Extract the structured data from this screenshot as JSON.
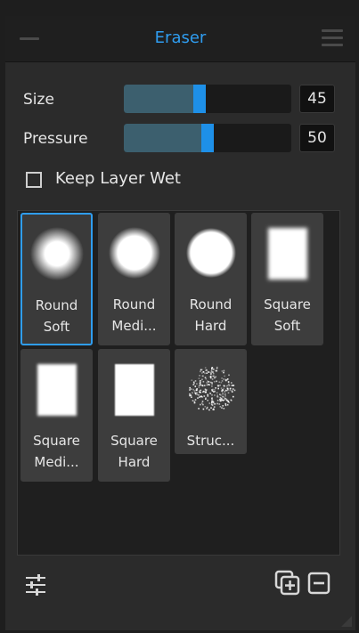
{
  "panel": {
    "title": "Eraser"
  },
  "controls": {
    "size": {
      "label": "Size",
      "value": "45",
      "fill_fraction": 0.45
    },
    "pressure": {
      "label": "Pressure",
      "value": "50",
      "fill_fraction": 0.5
    },
    "keep_layer_wet": {
      "label": "Keep Layer Wet",
      "checked": false
    }
  },
  "brushes": [
    {
      "line1": "Round",
      "line2": "Soft",
      "preview": "round-soft",
      "selected": true
    },
    {
      "line1": "Round",
      "line2": "Medi...",
      "preview": "round-medium",
      "selected": false
    },
    {
      "line1": "Round",
      "line2": "Hard",
      "preview": "round-hard",
      "selected": false
    },
    {
      "line1": "Square",
      "line2": "Soft",
      "preview": "square-soft",
      "selected": false
    },
    {
      "line1": "Square",
      "line2": "Medi...",
      "preview": "square-medium",
      "selected": false
    },
    {
      "line1": "Square",
      "line2": "Hard",
      "preview": "square-hard",
      "selected": false
    },
    {
      "line1": "Struc...",
      "line2": "",
      "preview": "structure",
      "selected": false
    }
  ],
  "colors": {
    "accent": "#2f9df0",
    "slider_thumb": "#1e90e8",
    "slider_fill": "#3c5f6e"
  },
  "icons": {
    "menu": "hamburger-menu-icon",
    "settings": "sliders-settings-icon",
    "duplicate": "duplicate-brush-icon",
    "remove": "remove-brush-icon"
  }
}
